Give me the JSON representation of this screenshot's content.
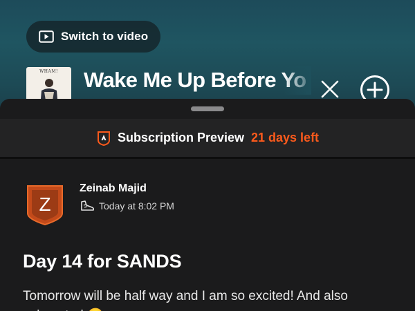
{
  "player": {
    "switch_video_label": "Switch to video",
    "song_title": "Wake Me Up Before You Go-Go",
    "album_art_text": "WHAM!",
    "close_icon": "close-icon",
    "add_icon": "add-circle-icon"
  },
  "subscription": {
    "logo_icon": "strava-logo-icon",
    "label": "Subscription Preview",
    "days_left": "21 days left",
    "accent_color": "#fc5a1c"
  },
  "post": {
    "avatar_letter": "Z",
    "author": "Zeinab Majid",
    "activity_icon": "shoe-icon",
    "timestamp": "Today at 8:02 PM",
    "title": "Day 14 for SANDS",
    "body": "Tomorrow will be half way and I am so excited! And also exhausted 🥱"
  }
}
